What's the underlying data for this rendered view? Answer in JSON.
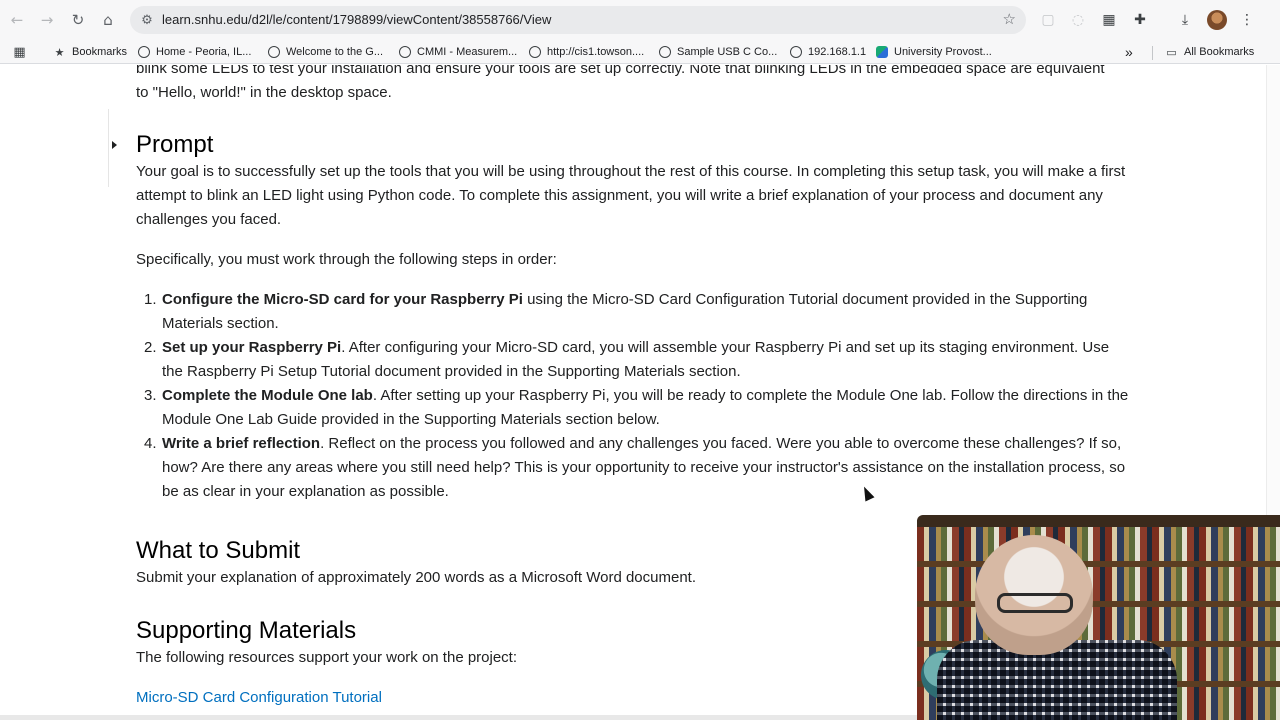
{
  "browser": {
    "url": "learn.snhu.edu/d2l/le/content/1798899/viewContent/38558766/View",
    "icons": {
      "back": "back-arrow-icon",
      "forward": "forward-arrow-icon",
      "reload": "reload-icon",
      "home": "home-icon",
      "site_info": "tune-icon",
      "bookmark_star": "star-icon",
      "extensions": "puzzle-icon",
      "downloads": "download-icon",
      "menu": "kebab-menu-icon"
    }
  },
  "bookmarks": {
    "apps_icon": "apps-grid-icon",
    "items": [
      {
        "label": "Bookmarks",
        "icon": "star-icon"
      },
      {
        "label": "Home - Peoria, IL...",
        "icon": "globe-icon"
      },
      {
        "label": "Welcome to the G...",
        "icon": "globe-icon"
      },
      {
        "label": "CMMI - Measurem...",
        "icon": "globe-icon"
      },
      {
        "label": "http://cis1.towson....",
        "icon": "globe-icon"
      },
      {
        "label": "Sample USB C Co...",
        "icon": "globe-icon"
      },
      {
        "label": "192.168.1.1",
        "icon": "globe-icon"
      },
      {
        "label": "University Provost...",
        "icon": "app-icon"
      }
    ],
    "overflow": "»",
    "all_bookmarks": "All Bookmarks"
  },
  "article": {
    "partial_intro": "blink some LEDs to test your installation and ensure your tools are set up correctly. Note that blinking LEDs in the embedded space are equivalent to \"Hello, world!\" in the desktop space.",
    "prompt_heading": "Prompt",
    "prompt_text": "Your goal is to successfully set up the tools that you will be using throughout the rest of this course. In completing this setup task, you will make a first attempt to blink an LED light using Python code. To complete this assignment, you will write a brief explanation of your process and document any challenges you faced.",
    "steps_intro": "Specifically, you must work through the following steps in order:",
    "steps": [
      {
        "num": "1.",
        "bold": "Configure the Micro-SD card for your Raspberry Pi",
        "text": " using the Micro-SD Card Configuration Tutorial document provided in the Supporting Materials section."
      },
      {
        "num": "2.",
        "bold": "Set up your Raspberry Pi",
        "text": ". After configuring your Micro-SD card, you will assemble your Raspberry Pi and set up its staging environment. Use the Raspberry Pi Setup Tutorial document provided in the Supporting Materials section."
      },
      {
        "num": "3.",
        "bold": "Complete the Module One lab",
        "text": ". After setting up your Raspberry Pi, you will be ready to complete the Module One lab. Follow the directions in the Module One Lab Guide provided in the Supporting Materials section below."
      },
      {
        "num": "4.",
        "bold": "Write a brief reflection",
        "text": ". Reflect on the process you followed and any challenges you faced. Were you able to overcome these challenges? If so, how? Are there any areas where you still need help? This is your opportunity to receive your instructor's assistance on the installation process, so be as clear in your explanation as possible."
      }
    ],
    "submit_heading": "What to Submit",
    "submit_text": "Submit your explanation of approximately 200 words as a Microsoft Word document.",
    "support_heading": "Supporting Materials",
    "support_text": "The following resources support your work on the project:",
    "link_tutorial": "Micro-SD Card Configuration Tutorial"
  },
  "colors": {
    "link": "#006fbf",
    "chrome_bg": "#f7f7f8",
    "omnibox_bg": "#e9eaec"
  }
}
